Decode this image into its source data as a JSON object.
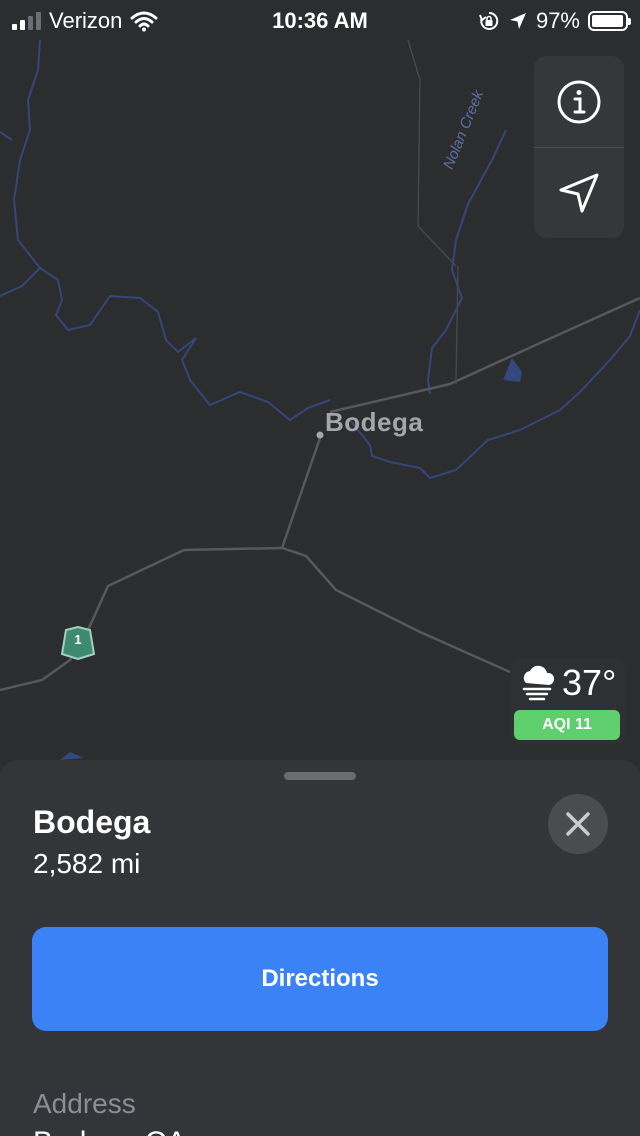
{
  "status_bar": {
    "carrier": "Verizon",
    "time": "10:36 AM",
    "battery_percent": "97%",
    "battery_level": 0.97,
    "signal_bars_filled": 2,
    "signal_bars_total": 4,
    "icons": [
      "signal-icon",
      "wifi-icon",
      "rotation-lock-icon",
      "location-arrow-icon",
      "battery-icon"
    ]
  },
  "map": {
    "town_label": "Bodega",
    "creek_label": "Nolan Creek",
    "route_number": "1",
    "colors": {
      "background": "#2b2d2f",
      "road": "#5a5d61",
      "water": "#3f4f86",
      "route_shield": "#3e8a6e"
    }
  },
  "controls": {
    "info_icon": "info-icon",
    "location_icon": "location-arrow-icon"
  },
  "weather": {
    "temperature": "37°",
    "aqi": "AQI 11",
    "icon": "fog-cloud-icon",
    "aqi_color": "#5fcf6e"
  },
  "sheet": {
    "title": "Bodega",
    "distance": "2,582 mi",
    "directions_label": "Directions",
    "address_label": "Address",
    "address_value": "Bodega CA",
    "accent_color": "#3b82f6"
  }
}
